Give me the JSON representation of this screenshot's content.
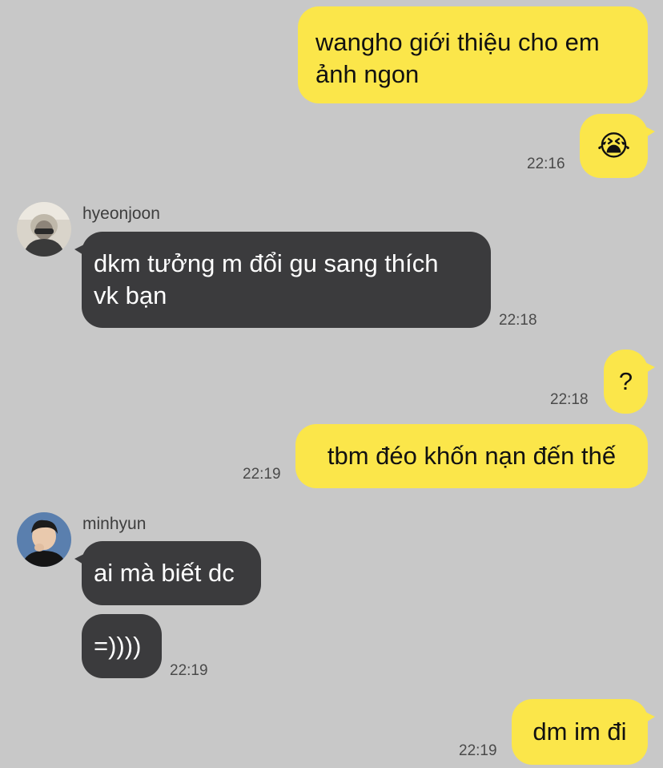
{
  "messages": [
    {
      "text": "wangho giới thiệu cho em ảnh ngon",
      "line1": "wangho giới thiệu cho em",
      "line2": "ảnh ngon"
    },
    {
      "emoji": "😭",
      "emoji_name": "loudly-crying-face",
      "time": "22:16"
    },
    {
      "sender": "hyeonjoon",
      "line1": "dkm tưởng m đổi gu sang thích",
      "line2": "vk bạn",
      "time": "22:18"
    },
    {
      "text": "?",
      "time": "22:18"
    },
    {
      "text": "tbm đéo khốn nạn đến thế",
      "time": "22:19"
    },
    {
      "sender": "minhyun",
      "text": "ai mà biết dc"
    },
    {
      "text": "=))))",
      "time": "22:19"
    },
    {
      "text": "dm im đi",
      "time": "22:19"
    }
  ],
  "colors": {
    "background": "#c8c8c8",
    "outgoing_bubble": "#fbe64a",
    "incoming_bubble": "#3b3b3d"
  }
}
